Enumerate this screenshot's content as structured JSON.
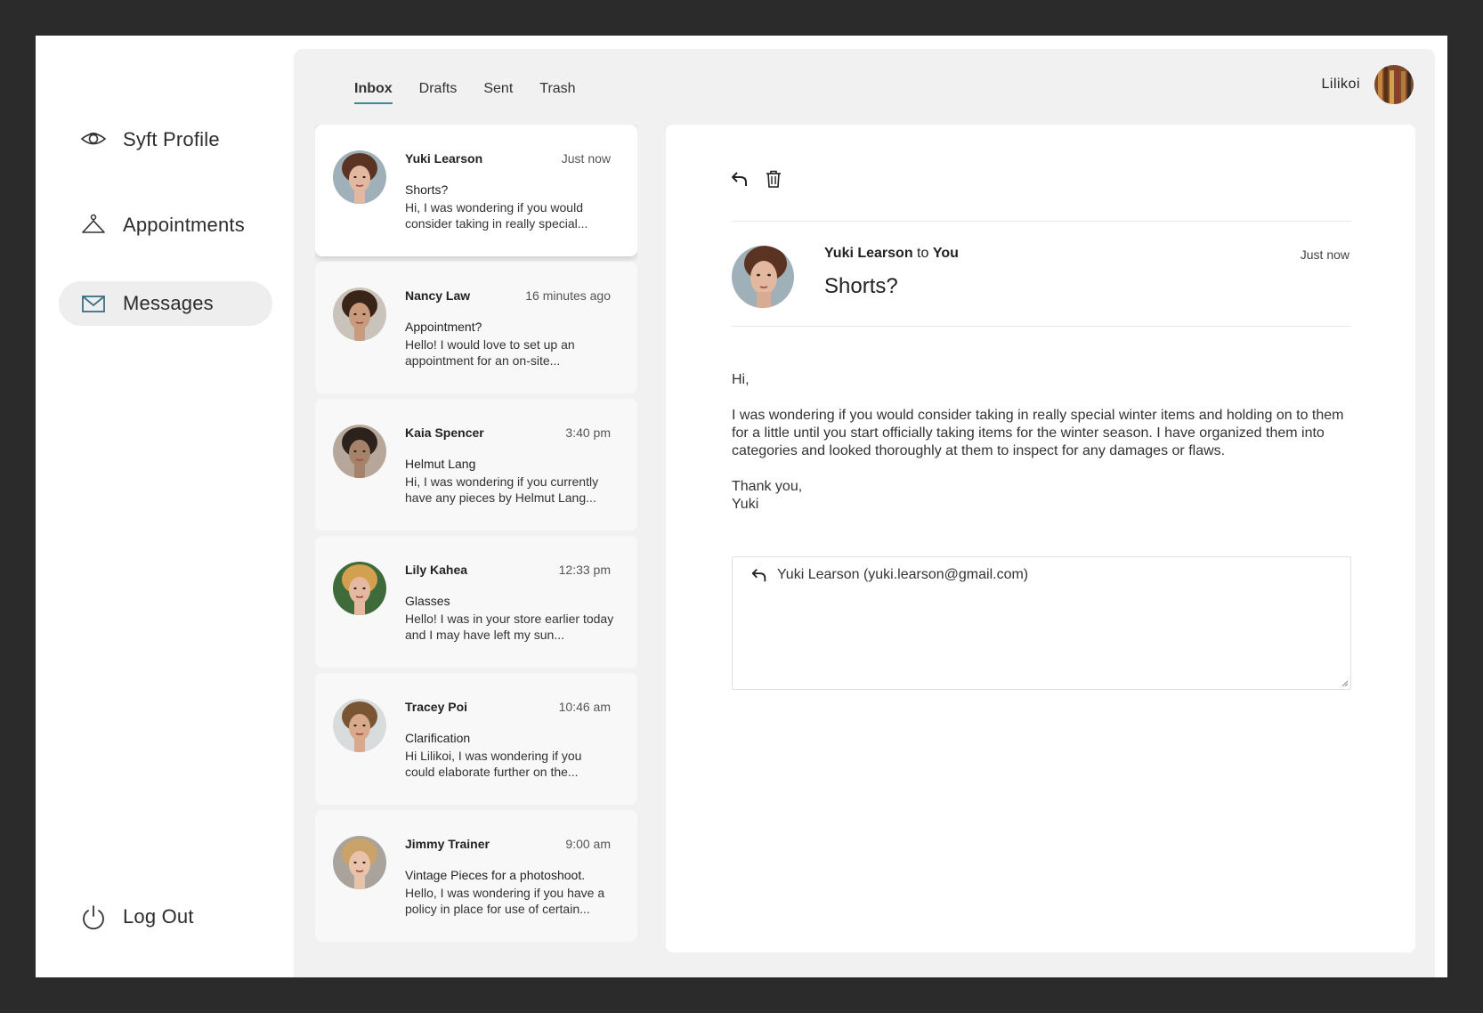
{
  "sidebar": {
    "items": [
      {
        "label": "Syft Profile",
        "icon": "eye-icon"
      },
      {
        "label": "Appointments",
        "icon": "hanger-icon"
      },
      {
        "label": "Messages",
        "icon": "envelope-icon",
        "active": true
      }
    ],
    "logout": {
      "label": "Log Out",
      "icon": "power-icon"
    }
  },
  "tabs": [
    "Inbox",
    "Drafts",
    "Sent",
    "Trash"
  ],
  "active_tab": "Inbox",
  "user": {
    "name": "Lilikoi"
  },
  "messages": [
    {
      "name": "Yuki Learson",
      "time": "Just now",
      "subject": "Shorts?",
      "preview": "Hi, I was wondering if you would consider taking in really special...",
      "selected": true
    },
    {
      "name": "Nancy Law",
      "time": "16 minutes ago",
      "subject": "Appointment?",
      "preview": "Hello!  I would love to set up an appointment for an on-site..."
    },
    {
      "name": "Kaia Spencer",
      "time": "3:40 pm",
      "subject": "Helmut Lang",
      "preview": "Hi, I was wondering if you currently have any pieces by Helmut Lang..."
    },
    {
      "name": "Lily Kahea",
      "time": "12:33 pm",
      "subject": "Glasses",
      "preview": "Hello!  I was in your store earlier today and I may have left my sun..."
    },
    {
      "name": "Tracey Poi",
      "time": "10:46 am",
      "subject": "Clarification",
      "preview": "Hi Lilikoi,  I was wondering if you could elaborate further on the..."
    },
    {
      "name": "Jimmy Trainer",
      "time": "9:00 am",
      "subject": "Vintage Pieces for a photoshoot.",
      "preview": "Hello, I was wondering if you have a policy in place for use of certain..."
    }
  ],
  "detail": {
    "sender": "Yuki Learson",
    "to_word": "to",
    "recipient": "You",
    "time": "Just now",
    "subject": "Shorts?",
    "greeting": "Hi,",
    "body": "I was wondering if you would consider taking in really special winter items and holding on to them for a little until you start officially taking items for the winter season.  I have organized them into categories and looked thoroughly at them to inspect for any damages or flaws.",
    "closing": "Thank you,",
    "signature": "Yuki",
    "reply_to": "Yuki Learson (yuki.learson@gmail.com)"
  },
  "colors": {
    "accent": "#3e8a8f",
    "icon": "#3a6f85",
    "background": "#f1f1f1"
  }
}
